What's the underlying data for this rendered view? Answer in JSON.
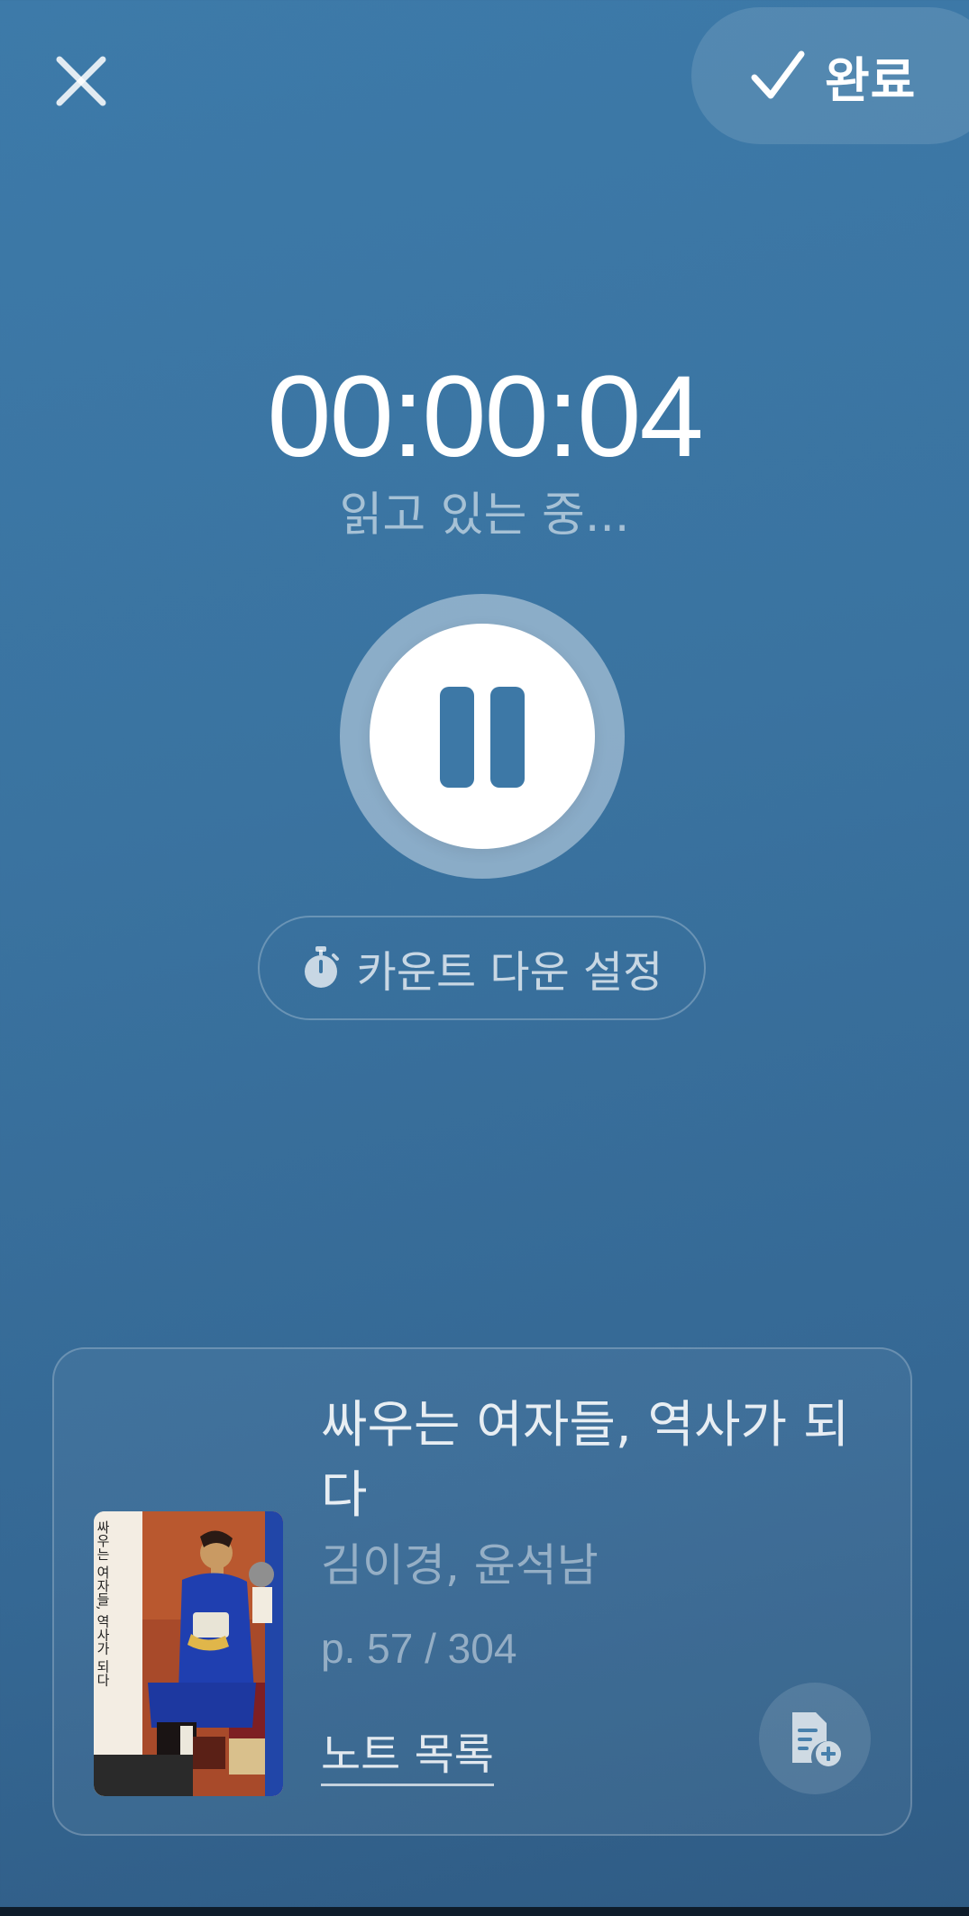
{
  "header": {
    "close_icon": "close-icon",
    "done_icon": "check-icon",
    "done_label": "완료"
  },
  "timer": {
    "elapsed": "00:00:04",
    "status": "읽고 있는 중..."
  },
  "controls": {
    "pause_icon": "pause-icon",
    "countdown_icon": "stopwatch-icon",
    "countdown_label": "카운트 다운 설정"
  },
  "book": {
    "title": "싸우는 여자들, 역사가 되다",
    "authors": "김이경, 윤석남",
    "page_progress": "p. 57 / 304",
    "notes_link": "노트 목록",
    "add_note_icon": "add-note-icon",
    "cover_text": "싸우는 여자들, 역사가 되다"
  },
  "colors": {
    "background": "#3a73a0",
    "accent": "#3d78a6",
    "white": "#ffffff"
  }
}
